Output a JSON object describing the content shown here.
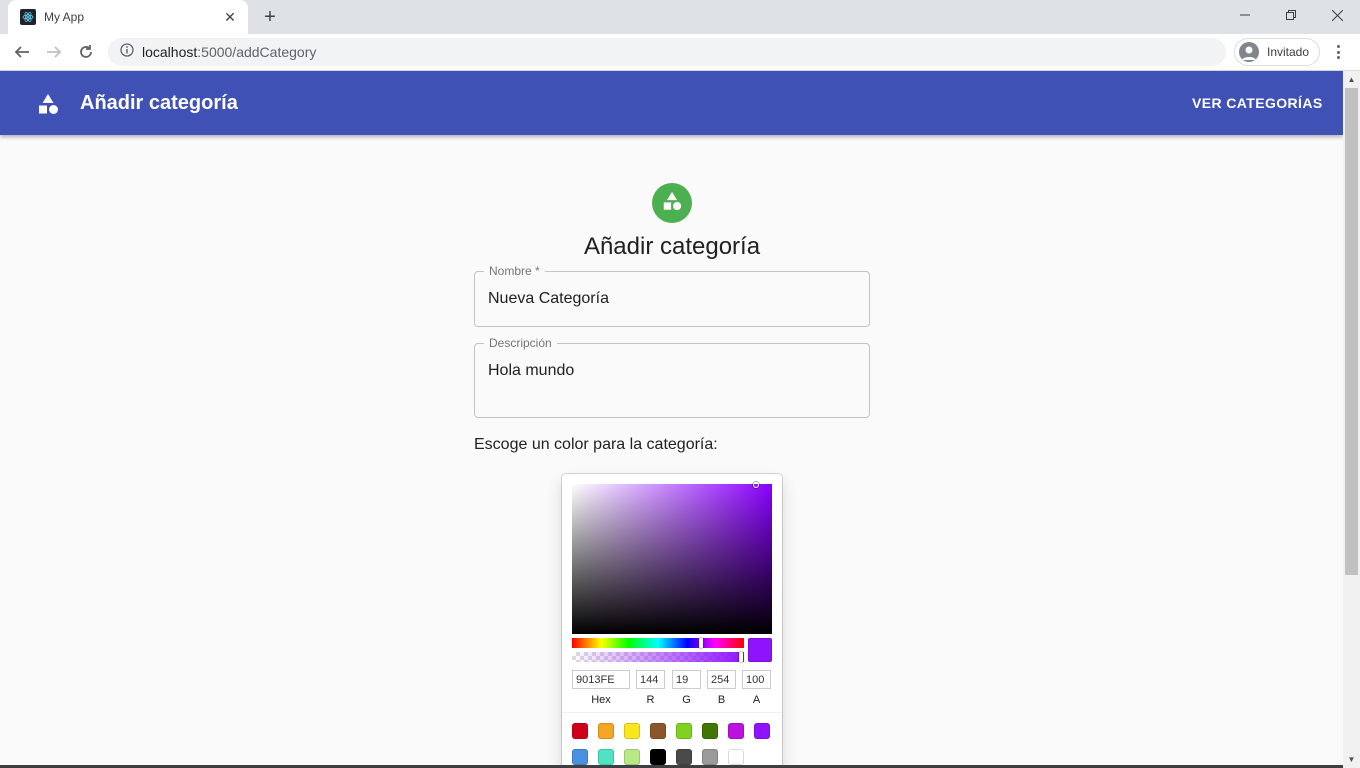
{
  "browser": {
    "tab_title": "My App",
    "url_host": "localhost",
    "url_path": ":5000/addCategory",
    "profile_label": "Invitado"
  },
  "appbar": {
    "title": "Añadir categoría",
    "nav_link": "VER CATEGORÍAS",
    "color": "#3f51b5"
  },
  "form": {
    "title": "Añadir categoría",
    "name_label": "Nombre *",
    "name_value": "Nueva Categoría",
    "description_label": "Descripción",
    "description_value": "Hola mundo",
    "color_prompt": "Escoge un color para la categoría:"
  },
  "picker": {
    "selected_color": "#9013FE",
    "hex_value": "9013FE",
    "r": "144",
    "g": "19",
    "b": "254",
    "a": "100",
    "labels": {
      "hex": "Hex",
      "r": "R",
      "g": "G",
      "b": "B",
      "a": "A"
    },
    "presets_row1": [
      "#D0021B",
      "#F5A623",
      "#F8E71C",
      "#8B572A",
      "#7ED321",
      "#417505",
      "#BD10E0",
      "#9013FE"
    ],
    "presets_row2": [
      "#4A90E2",
      "#50E3C2",
      "#B8E986",
      "#000000",
      "#4A4A4A",
      "#9B9B9B",
      "#FFFFFF"
    ]
  }
}
